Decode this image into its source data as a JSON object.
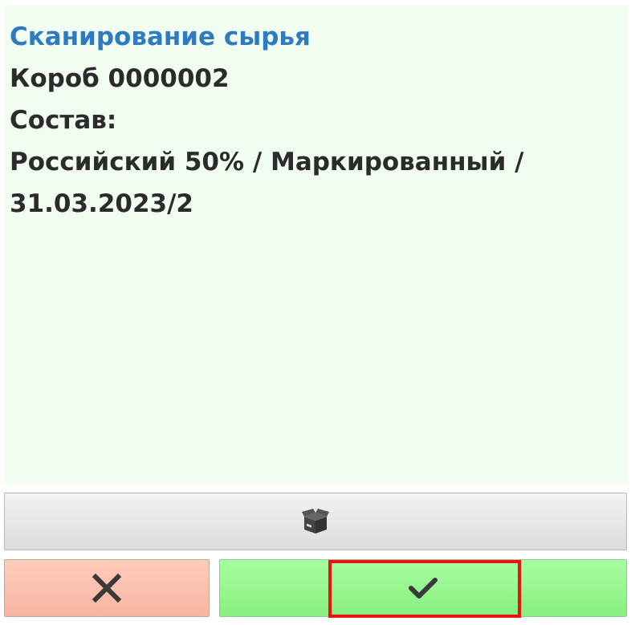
{
  "screen": {
    "title": "Сканирование сырья",
    "box_line": "Короб 0000002",
    "composition_label": "Состав:",
    "composition_line1": "Российский 50% / Маркированный /",
    "composition_line2": "31.03.2023/2"
  },
  "buttons": {
    "box_icon": "box-icon",
    "cancel_icon": "close-icon",
    "confirm_icon": "checkmark-icon"
  },
  "colors": {
    "title": "#2f7bbf",
    "text": "#2b2b2b",
    "panel_bg": "#f0fdf0",
    "cancel_bg": "#ffccbb",
    "confirm_bg": "#a8ffa0",
    "highlight": "#ee1111"
  }
}
